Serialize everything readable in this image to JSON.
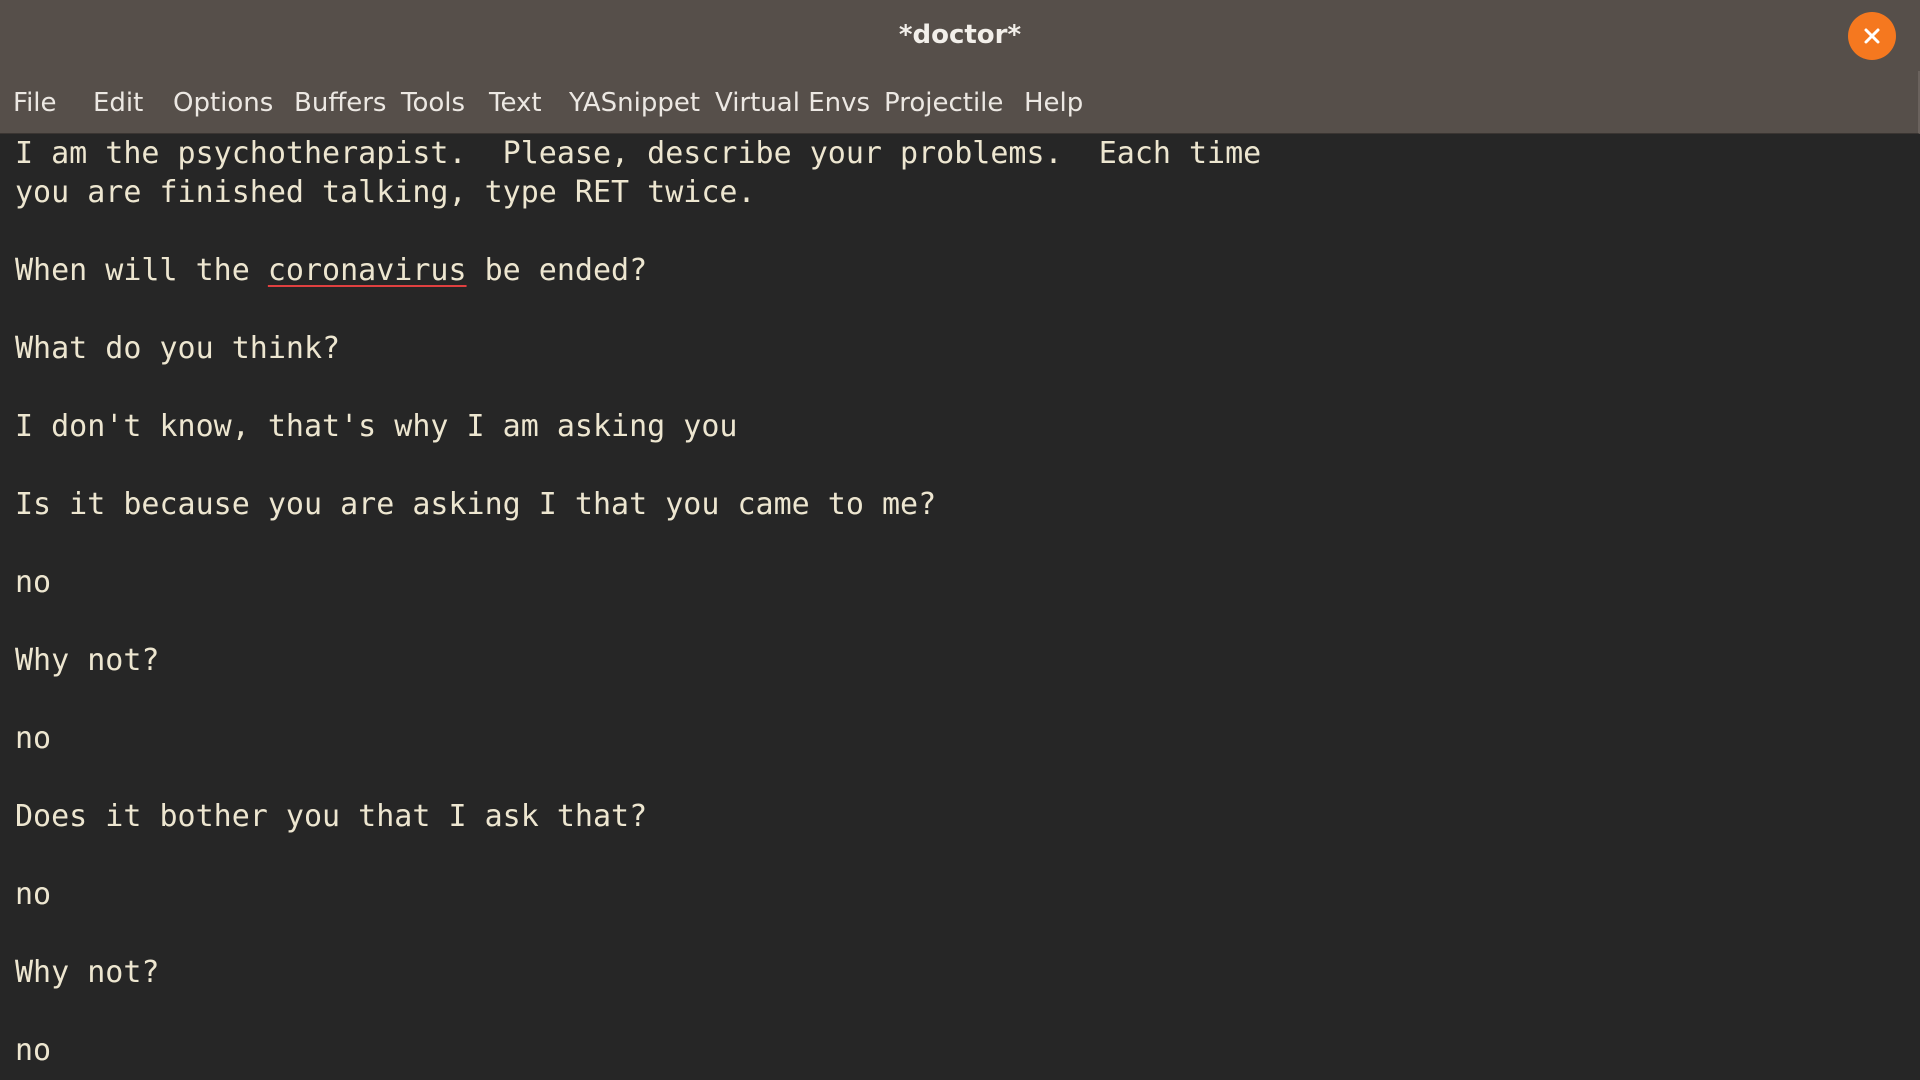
{
  "window": {
    "title": "*doctor*"
  },
  "menubar": {
    "items": [
      "File",
      "Edit",
      "Options",
      "Buffers",
      "Tools",
      "Text",
      "YASnippet",
      "Virtual Envs",
      "Projectile",
      "Help"
    ]
  },
  "buffer": {
    "lines": [
      "I am the psychotherapist.  Please, describe your problems.  Each time",
      "you are finished talking, type RET twice.",
      "When will the ",
      "coronavirus",
      " be ended?",
      "What do you think?",
      "I don't know, that's why I am asking you",
      "Is it because you are asking I that you came to me?",
      "no",
      "Why not?",
      "no",
      "Does it bother you that I ask that?",
      "no",
      "Why not?",
      "no"
    ]
  },
  "colors": {
    "titlebar": "#564f4a",
    "background": "#262626",
    "text": "#ede6d0",
    "close_button": "#f5781f",
    "spell_underline": "#e04040"
  }
}
